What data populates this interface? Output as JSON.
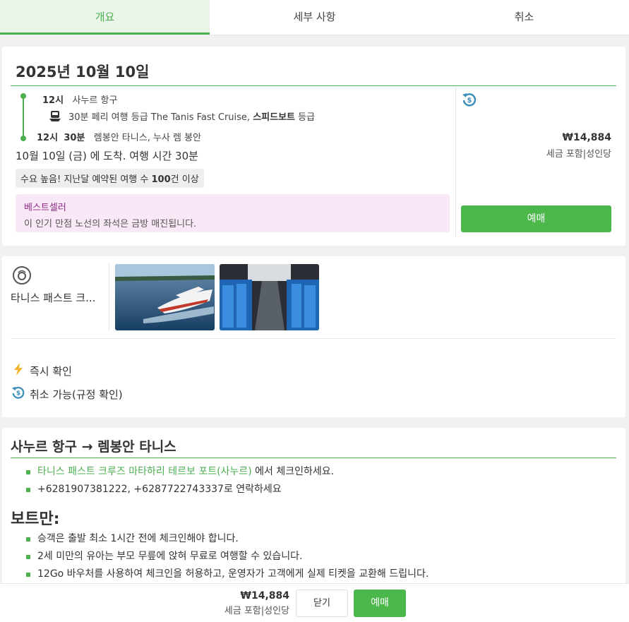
{
  "tabs": [
    "개요",
    "세부 사항",
    "취소"
  ],
  "trip": {
    "date": "2025년 10월 10일",
    "depart_time": "12시",
    "depart_place": "사누르 항구",
    "ferry_info_prefix": "30분 페리 여행 등급 The Tanis Fast Cruise,",
    "ferry_info_bold": "스피드보트",
    "ferry_info_suffix": "등급",
    "arrive_hour": "12시",
    "arrive_min": "30분",
    "arrive_place": "렘봉안 타니스, 누사 렘 봉안",
    "arrive_text": "10월 10일 (금) 에 도착. 여행 시간 30분",
    "demand_prefix": "수요 높음! 지난달 예약된 여행 수",
    "demand_count": "100",
    "demand_suffix": "건 이상",
    "best_title": "베스트셀러",
    "best_text": "이 인기 만점 노선의 좌석은 금방 매진됩니다.",
    "price": "₩14,884",
    "price_note": "세금 포함|성인당",
    "book_label": "예매"
  },
  "operator": {
    "name": "타니스 패스트 크...",
    "features": [
      "즉시 확인",
      "취소 가능(규정 확인)"
    ]
  },
  "route": {
    "title": "사누르 항구 → 렘봉안 타니스",
    "checkin_link": "타니스 패스트 크루즈 마타하리 테르보 포트(사누르)",
    "checkin_suffix": " 에서 체크인하세요.",
    "contact": "+6281907381222, +6287722743337로 연락하세요",
    "boat_title": "보트만:",
    "boat_items": [
      "승객은 출발 최소 1시간 전에 체크인해야 합니다.",
      "2세 미만의 유아는 부모 무릎에 앉혀 무료로 여행할 수 있습니다.",
      "12Go 바우처를 사용하여 체크인을 허용하고, 운영자가 고객에게 실제 티켓을 교환해 드립니다."
    ]
  },
  "footer": {
    "price": "₩14,884",
    "price_note": "세금 포함|성인당",
    "close_label": "닫기",
    "book_label": "예매"
  },
  "colors": {
    "accent": "#4caf50",
    "bestseller_bg": "#f9e9f6",
    "bestseller_title": "#8e2b87"
  },
  "icons": [
    "ferry-icon",
    "refund-icon",
    "lightning-icon",
    "operator-logo"
  ]
}
